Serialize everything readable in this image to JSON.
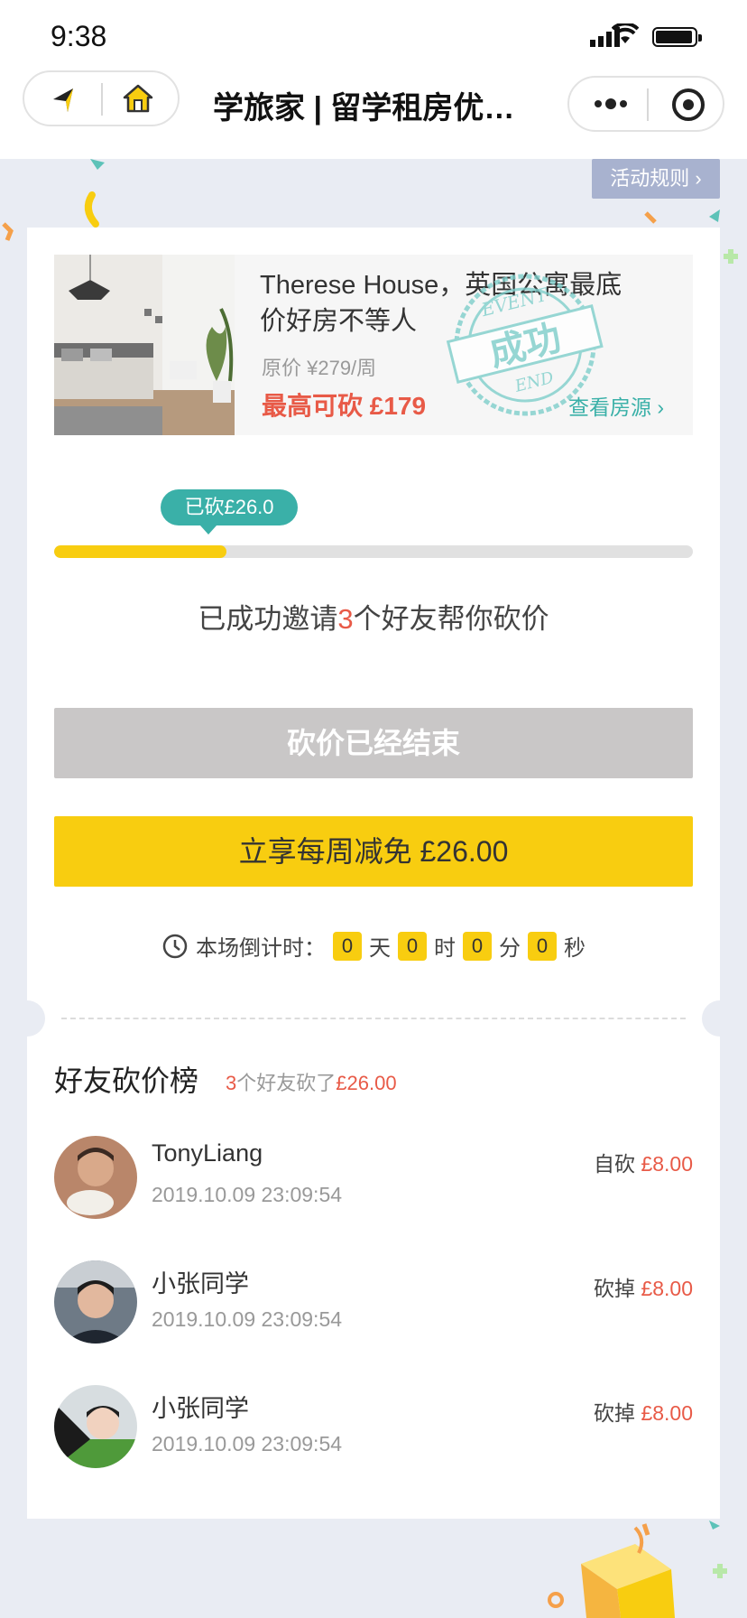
{
  "status_bar": {
    "time": "9:38"
  },
  "nav": {
    "title": "学旅家 | 留学租房优惠..."
  },
  "rules_label": "活动规则",
  "product": {
    "title": "Therese House，英国公寓最底价好房不等人",
    "original_price": "原价 ¥279/周",
    "max_cut": "最高可砍 £179",
    "view_link": "查看房源",
    "stamp": {
      "top": "EVENT",
      "main": "成功",
      "bottom": "END"
    }
  },
  "progress": {
    "bubble": "已砍£26.0",
    "fraction": 0.27
  },
  "invite": {
    "prefix": "已成功邀请",
    "count": "3",
    "suffix": "个好友帮你砍价"
  },
  "buttons": {
    "ended": "砍价已经结束",
    "claim": "立享每周减免 £26.00"
  },
  "countdown": {
    "label": "本场倒计时：",
    "days": "0",
    "days_unit": "天",
    "hours": "0",
    "hours_unit": "时",
    "minutes": "0",
    "minutes_unit": "分",
    "seconds": "0",
    "seconds_unit": "秒"
  },
  "board": {
    "title": "好友砍价榜",
    "sub_count": "3",
    "sub_mid": "个好友砍了",
    "sub_amount": "£26.00",
    "rows": [
      {
        "name": "TonyLiang",
        "time": "2019.10.09 23:09:54",
        "action": "自砍",
        "amount": "£8.00"
      },
      {
        "name": "小张同学",
        "time": "2019.10.09 23:09:54",
        "action": "砍掉",
        "amount": "£8.00"
      },
      {
        "name": "小张同学",
        "time": "2019.10.09 23:09:54",
        "action": "砍掉",
        "amount": "£8.00"
      }
    ]
  },
  "colors": {
    "accent_yellow": "#f8cd10",
    "teal": "#3ab0a8",
    "red": "#e85a47",
    "background": "#e9ecf3"
  }
}
